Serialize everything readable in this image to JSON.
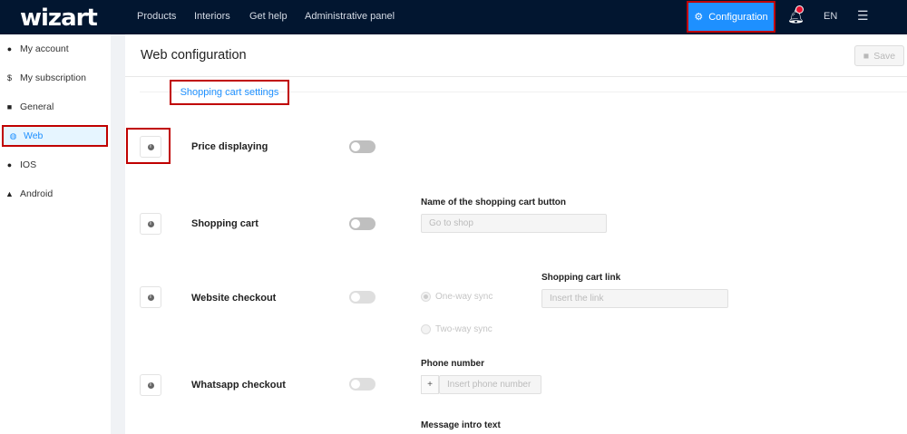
{
  "topbar": {
    "logo": "wizart",
    "nav": [
      "Products",
      "Interiors",
      "Get help",
      "Administrative panel"
    ],
    "configuration": "Configuration",
    "notifications_badge": "0",
    "language": "EN"
  },
  "sidebar": {
    "items": [
      {
        "label": "My account",
        "icon": "user-icon"
      },
      {
        "label": "My subscription",
        "icon": "dollar-icon"
      },
      {
        "label": "General",
        "icon": "box-icon"
      },
      {
        "label": "Web",
        "icon": "globe-icon",
        "active": true
      },
      {
        "label": "IOS",
        "icon": "apple-icon"
      },
      {
        "label": "Android",
        "icon": "android-icon"
      }
    ]
  },
  "main": {
    "title": "Web configuration",
    "save": "Save",
    "tab": "Shopping cart settings",
    "rows": [
      {
        "label": "Price displaying",
        "enabled": false
      },
      {
        "label": "Shopping cart",
        "enabled": false
      },
      {
        "label": "Website checkout",
        "enabled": false
      },
      {
        "label": "Whatsapp checkout",
        "enabled": false
      }
    ],
    "cart_button": {
      "label": "Name of the shopping cart button",
      "placeholder": "Go to shop"
    },
    "sync": {
      "one_way": "One-way sync",
      "two_way": "Two-way sync",
      "selected": "one_way"
    },
    "cart_link": {
      "label": "Shopping cart link",
      "placeholder": "Insert the link"
    },
    "phone": {
      "label": "Phone number",
      "prefix": "+",
      "placeholder": "Insert phone number"
    },
    "message_intro": {
      "label": "Message intro text"
    }
  },
  "colors": {
    "accent": "#1e90ff",
    "topbar": "#021630",
    "highlight": "#c00000"
  }
}
